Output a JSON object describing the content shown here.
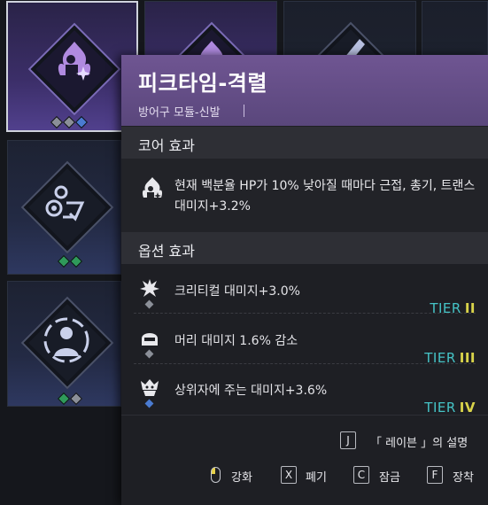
{
  "tooltip": {
    "title": "피크타임-격렬",
    "subtitle": "방어구 모듈-신발",
    "core_section_label": "코어 효과",
    "core_effect_text": "현재 백분율 HP가 10% 낮아질 때마다 근접, 총기, 트랜스 대미지+3.2%",
    "option_section_label": "옵션 효과",
    "options": [
      {
        "text": "크리티컬 대미지+3.0%",
        "tier_word": "TIER",
        "tier_num": "II",
        "tier_color": "#d9d34a",
        "pip_color": "#8b8f98",
        "icon": "explosion-icon"
      },
      {
        "text": "머리 대미지 1.6% 감소",
        "tier_word": "TIER",
        "tier_num": "III",
        "tier_color": "#d9d34a",
        "pip_color": "#8b8f98",
        "icon": "helmet-icon"
      },
      {
        "text": "상위자에 주는 대미지+3.6%",
        "tier_word": "TIER",
        "tier_num": "IV",
        "tier_color": "#d9d34a",
        "pip_color": "#4a7bd1",
        "icon": "boss-icon"
      }
    ],
    "describe_key": "J",
    "describe_label": "「 레이븐 」의 설명",
    "actions": [
      {
        "key": "",
        "label": "강화",
        "icon": "mouse-left-icon"
      },
      {
        "key": "X",
        "label": "폐기"
      },
      {
        "key": "C",
        "label": "잠금"
      },
      {
        "key": "F",
        "label": "장착"
      }
    ]
  },
  "colors": {
    "header_purple": "#6f5592",
    "tier_cyan": "#45c3c6",
    "tier_yellow": "#d9d34a",
    "pip_blue": "#4a7bd1",
    "pip_green": "#2f9a5a",
    "pip_gray": "#8b8f98"
  }
}
